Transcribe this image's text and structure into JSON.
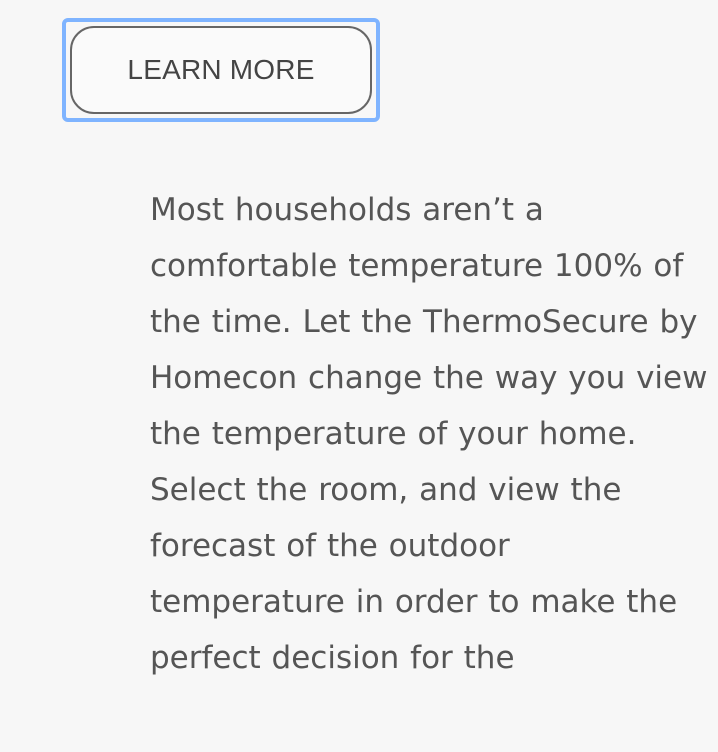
{
  "cta": {
    "label": "LEARN MORE"
  },
  "content": {
    "paragraph": "Most households aren’t a comfortable temperature 100% of the time. Let the ThermoSecure by Homecon change the way you view the temperature of your home. Select the room, and view the forecast of the outdoor temperature in order to make the perfect decision for the"
  }
}
